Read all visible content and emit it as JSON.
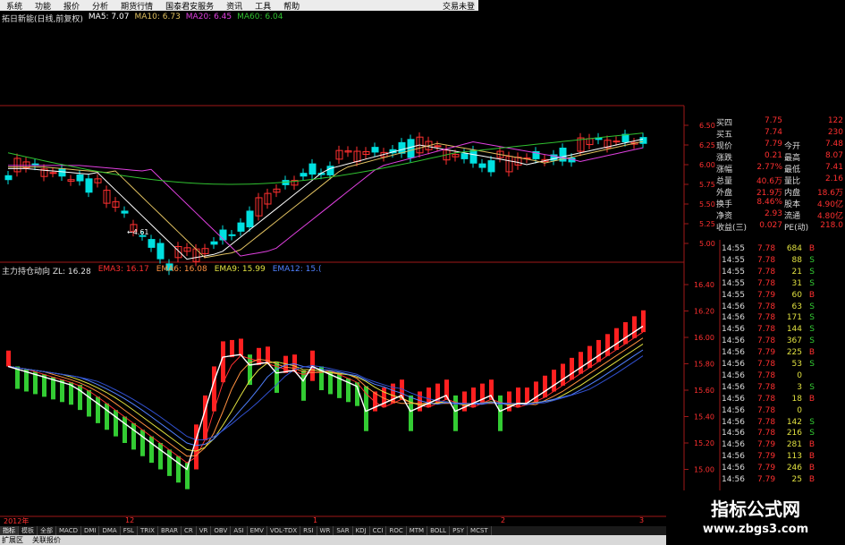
{
  "menu": {
    "items": [
      "系统",
      "功能",
      "报价",
      "分析",
      "期货行情",
      "国泰君安服务",
      "资讯",
      "工具",
      "帮助"
    ],
    "trade_label": "交易未登"
  },
  "title_line": {
    "stock": "拓日新能(日线,前复权)",
    "ma5": "MA5: 7.07",
    "ma10": "MA10: 6.73",
    "ma20": "MA20: 6.45",
    "ma60": "MA60: 6.04"
  },
  "indicator_line": {
    "name": "主力持仓动向 ZL: 16.28",
    "ema3": "EMA3: 16.17",
    "ema6": "EMA6: 16.08",
    "ema9": "EMA9: 15.99",
    "ema12": "EMA12: 15.("
  },
  "price_axis": [
    "6.50",
    "6.25",
    "6.00",
    "5.75",
    "5.50",
    "5.25",
    "5.00"
  ],
  "indicator_axis": [
    "16.40",
    "16.20",
    "16.00",
    "15.80",
    "15.60",
    "15.40",
    "15.20",
    "15.00"
  ],
  "low_marker": "←4.61",
  "quote_panel": [
    {
      "label": "买四",
      "value": "7.75",
      "vol": "122"
    },
    {
      "label": "买五",
      "value": "7.74",
      "vol": "230"
    },
    {
      "label": "现价",
      "value": "7.79",
      "label2": "今开",
      "value2": "7.48"
    },
    {
      "label": "涨跌",
      "value": "0.21",
      "label2": "最高",
      "value2": "8.07"
    },
    {
      "label": "涨幅",
      "value": "2.77%",
      "label2": "最低",
      "value2": "7.41"
    },
    {
      "label": "总量",
      "value": "40.6万",
      "label2": "量比",
      "value2": "2.16"
    },
    {
      "label": "外盘",
      "value": "21.9万",
      "label2": "内盘",
      "value2": "18.6万"
    },
    {
      "label": "换手",
      "value": "8.46%",
      "label2": "股本",
      "value2": "4.90亿"
    },
    {
      "label": "净资",
      "value": "2.93",
      "label2": "流通",
      "value2": "4.80亿"
    },
    {
      "label": "收益(三)",
      "value": "0.027",
      "label2": "PE(动)",
      "value2": "218.0"
    }
  ],
  "ticks": [
    {
      "time": "14:55",
      "price": "7.78",
      "vol": "684",
      "bs": "B"
    },
    {
      "time": "14:55",
      "price": "7.78",
      "vol": "88",
      "bs": "S"
    },
    {
      "time": "14:55",
      "price": "7.78",
      "vol": "21",
      "bs": "S"
    },
    {
      "time": "14:55",
      "price": "7.78",
      "vol": "31",
      "bs": "S"
    },
    {
      "time": "14:55",
      "price": "7.79",
      "vol": "60",
      "bs": "B"
    },
    {
      "time": "14:56",
      "price": "7.78",
      "vol": "63",
      "bs": "S"
    },
    {
      "time": "14:56",
      "price": "7.78",
      "vol": "171",
      "bs": "S"
    },
    {
      "time": "14:56",
      "price": "7.78",
      "vol": "144",
      "bs": "S"
    },
    {
      "time": "14:56",
      "price": "7.78",
      "vol": "367",
      "bs": "S"
    },
    {
      "time": "14:56",
      "price": "7.79",
      "vol": "225",
      "bs": "B"
    },
    {
      "time": "14:56",
      "price": "7.78",
      "vol": "53",
      "bs": "S"
    },
    {
      "time": "14:56",
      "price": "7.78",
      "vol": "0",
      "bs": ""
    },
    {
      "time": "14:56",
      "price": "7.78",
      "vol": "3",
      "bs": "S"
    },
    {
      "time": "14:56",
      "price": "7.78",
      "vol": "18",
      "bs": "B"
    },
    {
      "time": "14:56",
      "price": "7.78",
      "vol": "0",
      "bs": ""
    },
    {
      "time": "14:56",
      "price": "7.78",
      "vol": "142",
      "bs": "S"
    },
    {
      "time": "14:56",
      "price": "7.78",
      "vol": "216",
      "bs": "S"
    },
    {
      "time": "14:56",
      "price": "7.79",
      "vol": "281",
      "bs": "B"
    },
    {
      "time": "14:56",
      "price": "7.79",
      "vol": "113",
      "bs": "B"
    },
    {
      "time": "14:56",
      "price": "7.79",
      "vol": "246",
      "bs": "B"
    },
    {
      "time": "14:56",
      "price": "7.79",
      "vol": "25",
      "bs": "B"
    }
  ],
  "time_axis": [
    "2012年",
    "12",
    "1",
    "2",
    "3"
  ],
  "tabs": [
    "指标",
    "模板",
    "全部",
    "MACD",
    "DMI",
    "DMA",
    "FSL",
    "TRIX",
    "BRAR",
    "CR",
    "VR",
    "OBV",
    "ASI",
    "EMV",
    "VOL-TDX",
    "RSI",
    "WR",
    "SAR",
    "KDJ",
    "CCI",
    "ROC",
    "MTM",
    "BOLL",
    "PSY",
    "MCST"
  ],
  "status": [
    "扩展区",
    "关联报价"
  ],
  "watermark": {
    "line1": "指标公式网",
    "line2": "www.zbgs3.com"
  },
  "colors": {
    "up": "#ff3030",
    "down": "#00e0e0",
    "vol_up": "#ff2020",
    "vol_down": "#33cc33",
    "ma5": "#ffffff",
    "ma10": "#e0c060",
    "ma20": "#e040e0",
    "ma60": "#30c030"
  }
}
